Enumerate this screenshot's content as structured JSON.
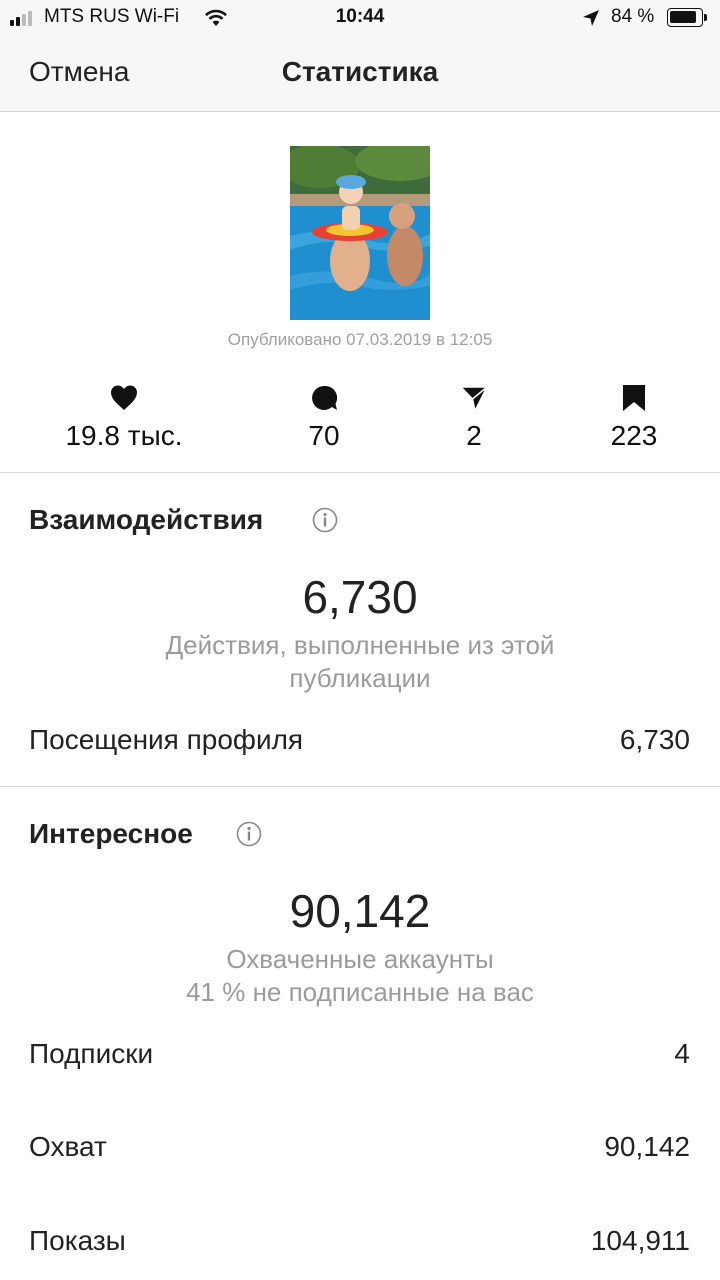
{
  "status_bar": {
    "carrier": "MTS RUS Wi-Fi",
    "time": "10:44",
    "battery": "84 %"
  },
  "nav": {
    "cancel": "Отмена",
    "title": "Статистика"
  },
  "post": {
    "published": "Опубликовано 07.03.2019 в 12:05"
  },
  "stats": {
    "likes": "19.8 тыс.",
    "comments": "70",
    "shares": "2",
    "saves": "223"
  },
  "interactions": {
    "title": "Взаимодействия",
    "total": "6,730",
    "subtitle_line1": "Действия, выполненные из этой",
    "subtitle_line2": "публикации",
    "rows": [
      {
        "label": "Посещения профиля",
        "value": "6,730"
      }
    ]
  },
  "discovery": {
    "title": "Интересное",
    "total": "90,142",
    "subtitle_line1": "Охваченные аккаунты",
    "subtitle_line2": "41 % не подписанные на вас",
    "rows": [
      {
        "label": "Подписки",
        "value": "4"
      },
      {
        "label": "Охват",
        "value": "90,142"
      },
      {
        "label": "Показы",
        "value": "104,911"
      }
    ]
  },
  "colors": {
    "bar_bg": "#f7f7f7",
    "text": "#222222",
    "muted": "#9b9b9b"
  }
}
